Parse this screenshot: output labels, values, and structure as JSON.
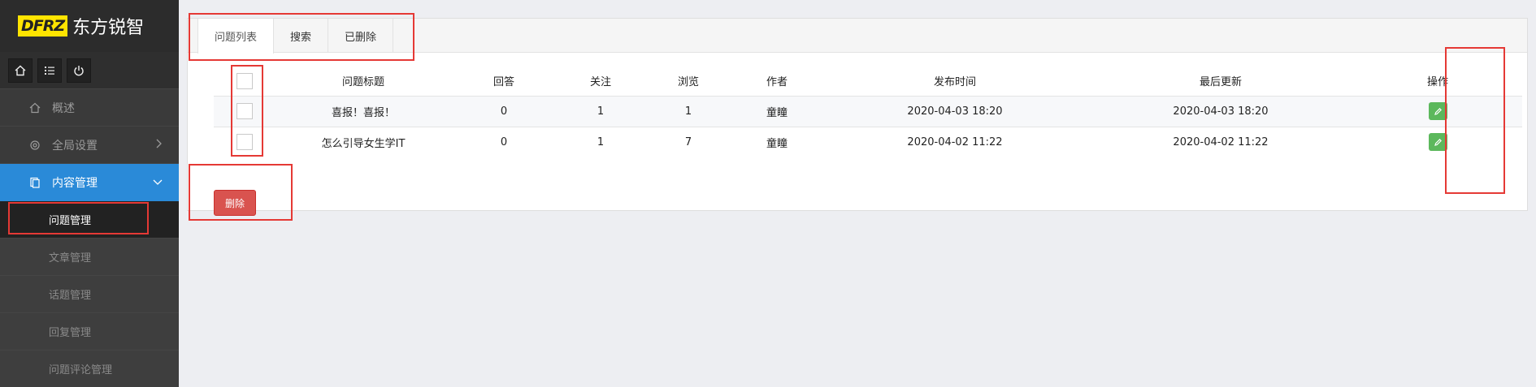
{
  "brand": {
    "badge": "DFRZ",
    "name": "东方锐智"
  },
  "quick_buttons": [
    {
      "icon": "home-icon"
    },
    {
      "icon": "list-icon"
    },
    {
      "icon": "power-icon"
    }
  ],
  "nav": {
    "overview": "概述",
    "settings": "全局设置",
    "content": "内容管理",
    "sub": [
      "问题管理",
      "文章管理",
      "话题管理",
      "回复管理",
      "问题评论管理"
    ]
  },
  "tabs": [
    "问题列表",
    "搜索",
    "已删除"
  ],
  "table": {
    "headers": [
      "问题标题",
      "回答",
      "关注",
      "浏览",
      "作者",
      "发布时间",
      "最后更新",
      "操作"
    ],
    "rows": [
      {
        "title": "喜报！喜报！",
        "answers": "0",
        "follows": "1",
        "views": "1",
        "author": "童瞳",
        "published": "2020-04-03 18:20",
        "updated": "2020-04-03 18:20"
      },
      {
        "title": "怎么引导女生学IT",
        "answers": "0",
        "follows": "1",
        "views": "7",
        "author": "童瞳",
        "published": "2020-04-02 11:22",
        "updated": "2020-04-02 11:22"
      }
    ]
  },
  "delete_button": "删除",
  "colors": {
    "sidebar": "#3a3a3a",
    "active_nav": "#2a8ad8",
    "delete": "#d9534f",
    "edit": "#5cb85c",
    "annotation": "#e53935"
  }
}
